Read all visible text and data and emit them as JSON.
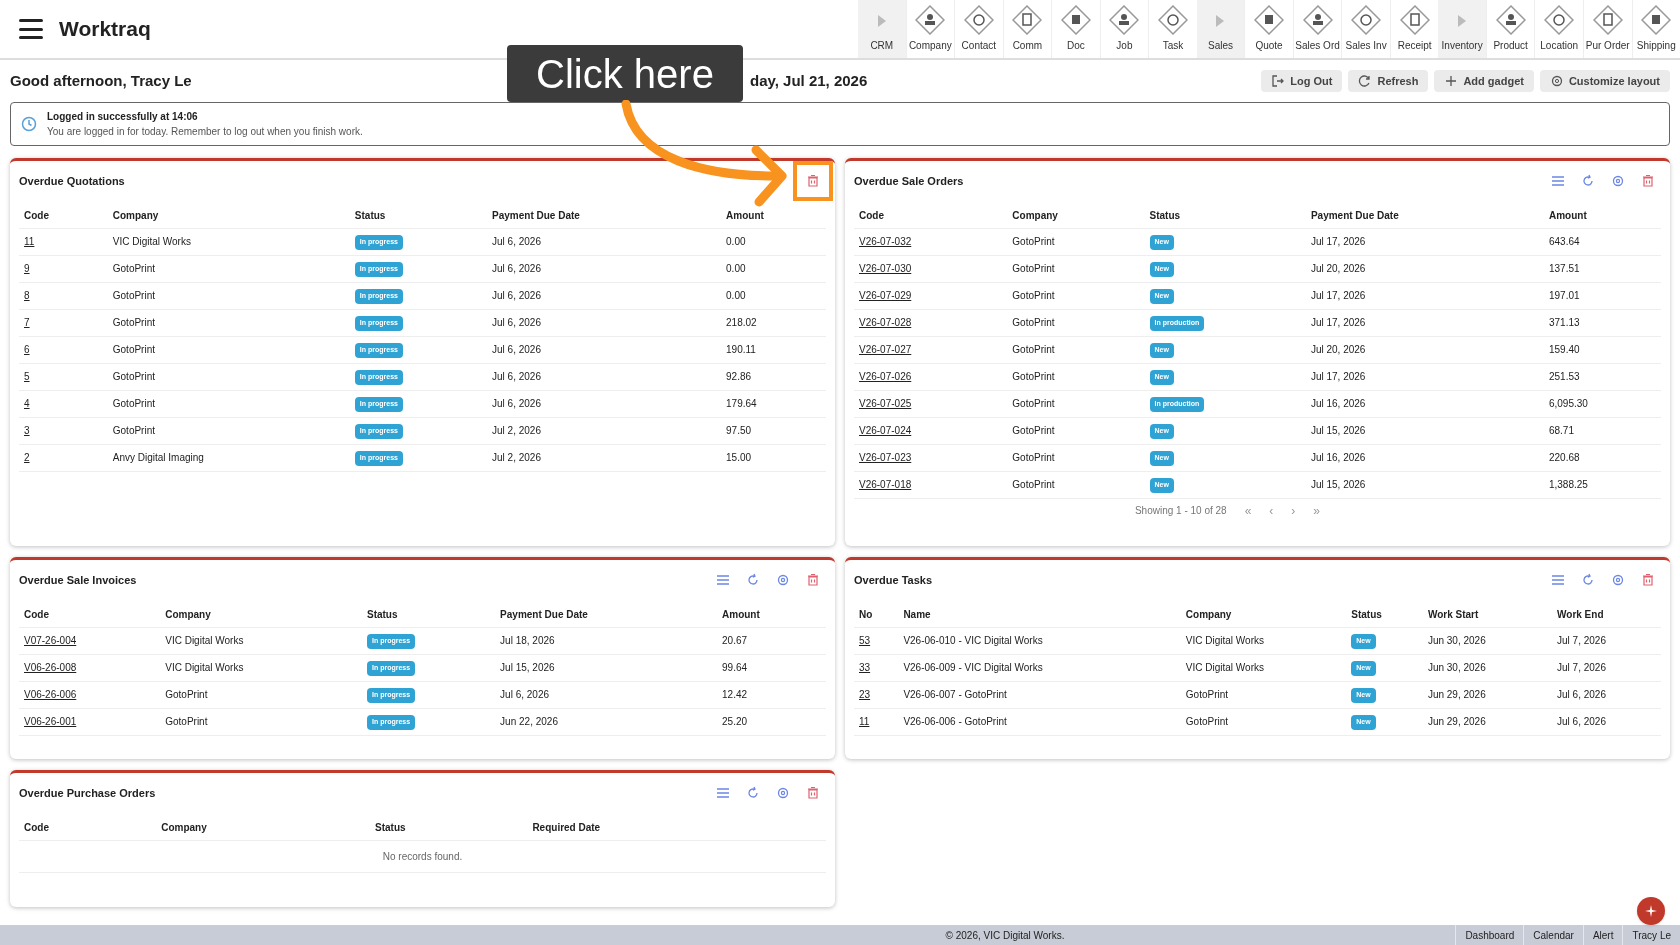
{
  "app": {
    "title": "Worktraq"
  },
  "nav": [
    {
      "label": "CRM",
      "kind": "section"
    },
    {
      "label": "Company",
      "kind": "module"
    },
    {
      "label": "Contact",
      "kind": "module"
    },
    {
      "label": "Comm",
      "kind": "module"
    },
    {
      "label": "Doc",
      "kind": "module"
    },
    {
      "label": "Job",
      "kind": "module"
    },
    {
      "label": "Task",
      "kind": "module"
    },
    {
      "label": "Sales",
      "kind": "section"
    },
    {
      "label": "Quote",
      "kind": "module"
    },
    {
      "label": "Sales Ord",
      "kind": "module"
    },
    {
      "label": "Sales Inv",
      "kind": "module"
    },
    {
      "label": "Receipt",
      "kind": "module"
    },
    {
      "label": "Inventory",
      "kind": "section"
    },
    {
      "label": "Product",
      "kind": "module"
    },
    {
      "label": "Location",
      "kind": "module"
    },
    {
      "label": "Pur Order",
      "kind": "module"
    },
    {
      "label": "Shipping",
      "kind": "module"
    }
  ],
  "greeting": "Good afternoon, Tracy Le",
  "date": "day, Jul 21, 2026",
  "buttons": [
    {
      "label": "Log Out",
      "kind": "logout"
    },
    {
      "label": "Refresh",
      "kind": "refresh"
    },
    {
      "label": "Add gadget",
      "kind": "add"
    },
    {
      "label": "Customize layout",
      "kind": "settings"
    }
  ],
  "alert": {
    "title": "Logged in successfully at 14:06",
    "message": "You are logged in for today. Remember to log out when you finish work."
  },
  "callout": {
    "text": "Click here"
  },
  "gadgets": [
    {
      "title": "Overdue Quotations",
      "actions": [
        {
          "kind": "delete",
          "highlighted": true
        }
      ],
      "columns": [
        {
          "label": "Code",
          "kind": "link"
        },
        {
          "label": "Company",
          "kind": "text"
        },
        {
          "label": "Status",
          "kind": "badge"
        },
        {
          "label": "Payment Due Date",
          "kind": "text"
        },
        {
          "label": "Amount",
          "kind": "text"
        }
      ],
      "rows": [
        [
          "11",
          "VIC Digital Works",
          "In progress",
          "Jul 6, 2026",
          "0.00"
        ],
        [
          "9",
          "GotoPrint",
          "In progress",
          "Jul 6, 2026",
          "0.00"
        ],
        [
          "8",
          "GotoPrint",
          "In progress",
          "Jul 6, 2026",
          "0.00"
        ],
        [
          "7",
          "GotoPrint",
          "In progress",
          "Jul 6, 2026",
          "218.02"
        ],
        [
          "6",
          "GotoPrint",
          "In progress",
          "Jul 6, 2026",
          "190.11"
        ],
        [
          "5",
          "GotoPrint",
          "In progress",
          "Jul 6, 2026",
          "92.86"
        ],
        [
          "4",
          "GotoPrint",
          "In progress",
          "Jul 6, 2026",
          "179.64"
        ],
        [
          "3",
          "GotoPrint",
          "In progress",
          "Jul 2, 2026",
          "97.50"
        ],
        [
          "2",
          "Anvy Digital Imaging",
          "In progress",
          "Jul 2, 2026",
          "15.00"
        ]
      ]
    },
    {
      "title": "Overdue Sale Orders",
      "actions": [
        {
          "kind": "menu",
          "highlighted": false
        },
        {
          "kind": "refresh",
          "highlighted": false
        },
        {
          "kind": "settings",
          "highlighted": false
        },
        {
          "kind": "delete",
          "highlighted": false
        }
      ],
      "columns": [
        {
          "label": "Code",
          "kind": "link"
        },
        {
          "label": "Company",
          "kind": "text"
        },
        {
          "label": "Status",
          "kind": "badge"
        },
        {
          "label": "Payment Due Date",
          "kind": "text"
        },
        {
          "label": "Amount",
          "kind": "text"
        }
      ],
      "rows": [
        [
          "V26-07-032",
          "GotoPrint",
          "New",
          "Jul 17, 2026",
          "643.64"
        ],
        [
          "V26-07-030",
          "GotoPrint",
          "New",
          "Jul 20, 2026",
          "137.51"
        ],
        [
          "V26-07-029",
          "GotoPrint",
          "New",
          "Jul 17, 2026",
          "197.01"
        ],
        [
          "V26-07-028",
          "GotoPrint",
          "In production",
          "Jul 17, 2026",
          "371.13"
        ],
        [
          "V26-07-027",
          "GotoPrint",
          "New",
          "Jul 20, 2026",
          "159.40"
        ],
        [
          "V26-07-026",
          "GotoPrint",
          "New",
          "Jul 17, 2026",
          "251.53"
        ],
        [
          "V26-07-025",
          "GotoPrint",
          "In production",
          "Jul 16, 2026",
          "6,095.30"
        ],
        [
          "V26-07-024",
          "GotoPrint",
          "New",
          "Jul 15, 2026",
          "68.71"
        ],
        [
          "V26-07-023",
          "GotoPrint",
          "New",
          "Jul 16, 2026",
          "220.68"
        ],
        [
          "V26-07-018",
          "GotoPrint",
          "New",
          "Jul 15, 2026",
          "1,388.25"
        ]
      ],
      "pagination": {
        "summary": "Showing 1 - 10 of 28",
        "controls": [
          "«",
          "‹",
          "›",
          "»"
        ]
      }
    },
    {
      "title": "Overdue Sale Invoices",
      "actions": [
        {
          "kind": "menu",
          "highlighted": false
        },
        {
          "kind": "refresh",
          "highlighted": false
        },
        {
          "kind": "settings",
          "highlighted": false
        },
        {
          "kind": "delete",
          "highlighted": false
        }
      ],
      "columns": [
        {
          "label": "Code",
          "kind": "link"
        },
        {
          "label": "Company",
          "kind": "text"
        },
        {
          "label": "Status",
          "kind": "badge"
        },
        {
          "label": "Payment Due Date",
          "kind": "text"
        },
        {
          "label": "Amount",
          "kind": "text"
        }
      ],
      "rows": [
        [
          "V07-26-004",
          "VIC Digital Works",
          "In progress",
          "Jul 18, 2026",
          "20.67"
        ],
        [
          "V06-26-008",
          "VIC Digital Works",
          "In progress",
          "Jul 15, 2026",
          "99.64"
        ],
        [
          "V06-26-006",
          "GotoPrint",
          "In progress",
          "Jul 6, 2026",
          "12.42"
        ],
        [
          "V06-26-001",
          "GotoPrint",
          "In progress",
          "Jun 22, 2026",
          "25.20"
        ]
      ]
    },
    {
      "title": "Overdue Tasks",
      "actions": [
        {
          "kind": "menu",
          "highlighted": false
        },
        {
          "kind": "refresh",
          "highlighted": false
        },
        {
          "kind": "settings",
          "highlighted": false
        },
        {
          "kind": "delete",
          "highlighted": false
        }
      ],
      "columns": [
        {
          "label": "No",
          "kind": "link"
        },
        {
          "label": "Name",
          "kind": "text"
        },
        {
          "label": "Company",
          "kind": "text"
        },
        {
          "label": "Status",
          "kind": "badge"
        },
        {
          "label": "Work Start",
          "kind": "text"
        },
        {
          "label": "Work End",
          "kind": "text"
        }
      ],
      "rows": [
        [
          "53",
          "V26-06-010 - VIC Digital Works",
          "VIC Digital Works",
          "New",
          "Jun 30, 2026",
          "Jul 7, 2026"
        ],
        [
          "33",
          "V26-06-009 - VIC Digital Works",
          "VIC Digital Works",
          "New",
          "Jun 30, 2026",
          "Jul 7, 2026"
        ],
        [
          "23",
          "V26-06-007 - GotoPrint",
          "GotoPrint",
          "New",
          "Jun 29, 2026",
          "Jul 6, 2026"
        ],
        [
          "11",
          "V26-06-006 - GotoPrint",
          "GotoPrint",
          "New",
          "Jun 29, 2026",
          "Jul 6, 2026"
        ]
      ]
    },
    {
      "title": "Overdue Purchase Orders",
      "actions": [
        {
          "kind": "menu",
          "highlighted": false
        },
        {
          "kind": "refresh",
          "highlighted": false
        },
        {
          "kind": "settings",
          "highlighted": false
        },
        {
          "kind": "delete",
          "highlighted": false
        }
      ],
      "columns": [
        {
          "label": "Code"
        },
        {
          "label": "Company"
        },
        {
          "label": "Status"
        },
        {
          "label": "Required Date"
        }
      ],
      "empty_message": "No records found."
    }
  ],
  "footer": {
    "copyright": "© 2026, VIC Digital Works.",
    "links": [
      "Dashboard",
      "Calendar",
      "Alert",
      "Tracy Le"
    ]
  }
}
